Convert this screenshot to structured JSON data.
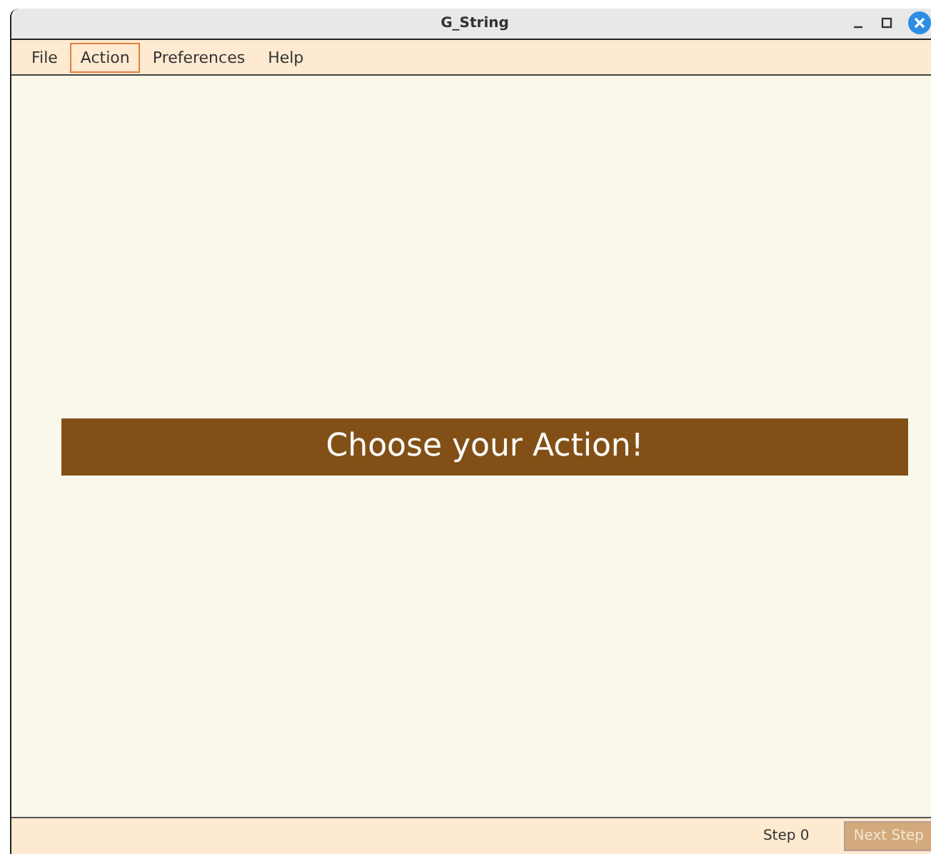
{
  "window": {
    "title": "G_String"
  },
  "menu": [
    {
      "label": "File",
      "selected": false
    },
    {
      "label": "Action",
      "selected": true
    },
    {
      "label": "Preferences",
      "selected": false
    },
    {
      "label": "Help",
      "selected": false
    }
  ],
  "banner": {
    "text": "Choose your Action!"
  },
  "status_bar": {
    "step": "Step 0",
    "next_button": {
      "label": "Next Step",
      "disabled": true
    }
  }
}
